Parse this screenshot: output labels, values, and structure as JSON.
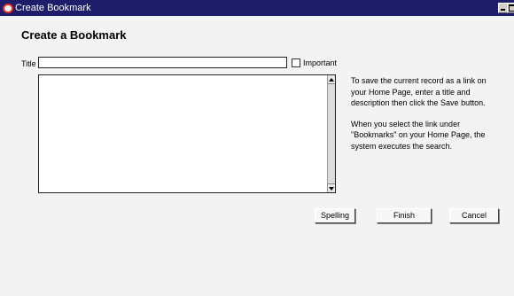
{
  "window": {
    "title": "Create Bookmark"
  },
  "page": {
    "heading": "Create a Bookmark"
  },
  "form": {
    "title_label": "Title",
    "title_value": "",
    "important_label": "Important",
    "important_checked": false,
    "description_value": ""
  },
  "help": {
    "paragraph1": "To save the current record as a link on your Home Page, enter a title and description then click the Save button.",
    "paragraph2": "When you select the link under \"Bookmarks\" on your Home Page, the system executes the search."
  },
  "buttons": {
    "spelling": "Spelling",
    "finish": "Finish",
    "cancel": "Cancel"
  },
  "colors": {
    "titlebar": "#1d1d69",
    "background": "#f3f3f3",
    "logo": "#e03020"
  }
}
